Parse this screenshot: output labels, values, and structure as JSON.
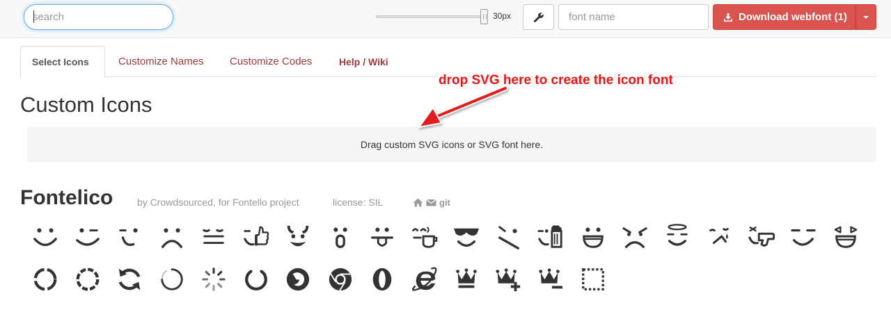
{
  "toolbar": {
    "search_placeholder": "search",
    "icon_size_label": "30px",
    "icon_size_value": 30,
    "font_name_placeholder": "font name",
    "download_label": "Download webfont (1)"
  },
  "tabs": [
    {
      "label": "Select Icons",
      "active": true
    },
    {
      "label": "Customize Names",
      "active": false
    },
    {
      "label": "Customize Codes",
      "active": false
    },
    {
      "label": "Help / Wiki",
      "active": false
    }
  ],
  "custom": {
    "title": "Custom Icons",
    "dropzone_text": "Drag custom SVG icons or SVG font here.",
    "annotation": "drop SVG here to create the icon font"
  },
  "fontelico": {
    "title": "Fontelico",
    "author": "by Crowdsourced, for Fontello project",
    "license": "license: SIL",
    "git_label": "git",
    "icons_row1": [
      "emo-happy",
      "emo-wink",
      "emo-wink2",
      "emo-unhappy",
      "emo-sleep",
      "emo-thumbsup",
      "emo-devil",
      "emo-surprised",
      "emo-tongue",
      "emo-coffee",
      "emo-sunglasses",
      "emo-displeased",
      "emo-beer",
      "emo-grin",
      "emo-angry",
      "emo-saint",
      "emo-cry",
      "emo-shoot",
      "emo-squint",
      "emo-laugh"
    ],
    "icons_row2": [
      "spin1",
      "spin2",
      "spin3",
      "spin4",
      "spin5",
      "spin6",
      "firefox",
      "chrome",
      "opera",
      "ie",
      "crown",
      "crown-plus",
      "crown-minus",
      "marquee"
    ]
  },
  "colors": {
    "accent_red": "#d9534f",
    "tab_link": "#9c3a3a",
    "annotation": "#ee1111"
  }
}
